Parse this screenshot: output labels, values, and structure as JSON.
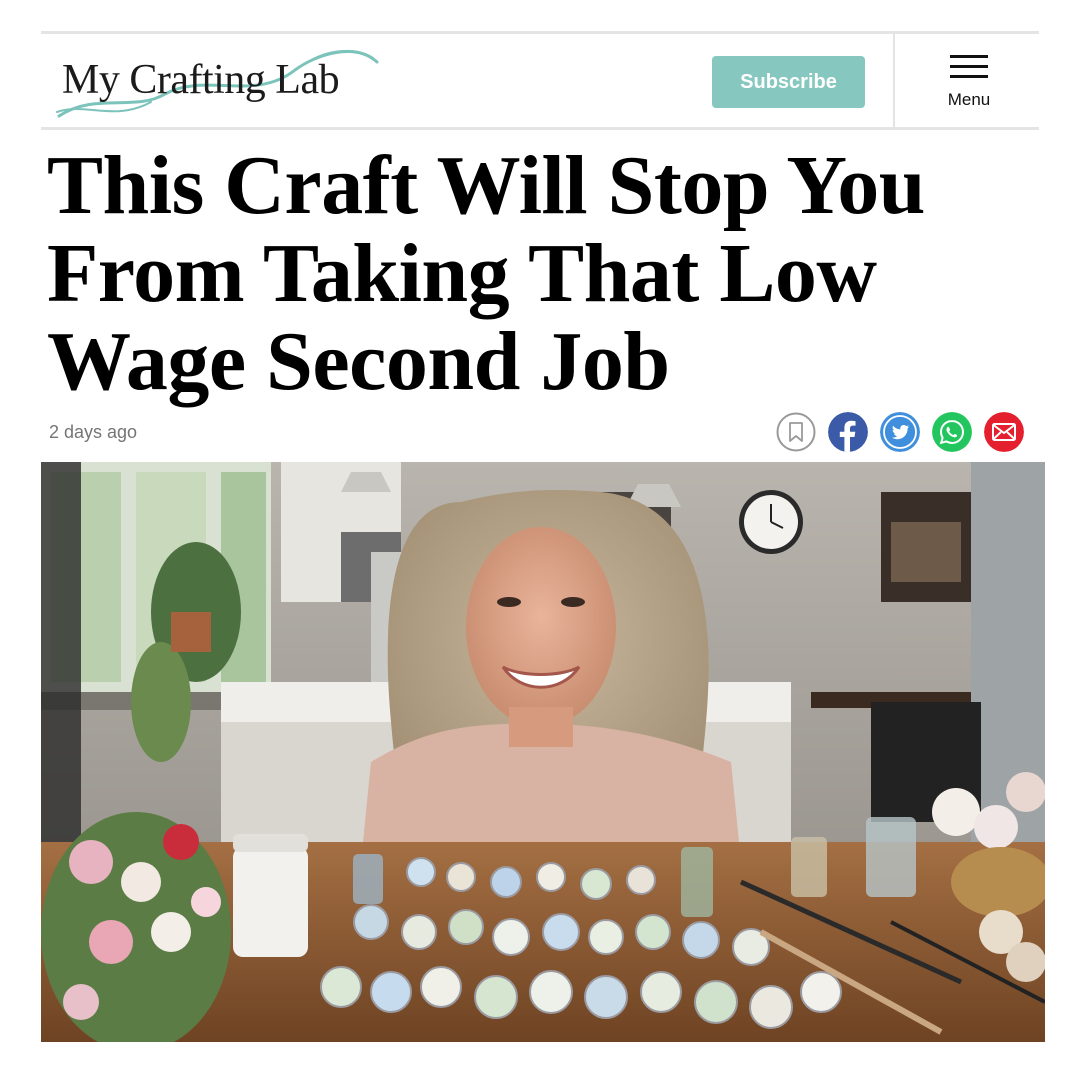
{
  "header": {
    "logo_text": "My Crafting Lab",
    "subscribe_label": "Subscribe",
    "menu_label": "Menu"
  },
  "article": {
    "headline": "This Craft Will Stop You From Taking That Low Wage Second Job",
    "date": "2 days ago"
  },
  "share_icons": [
    "bookmark-icon",
    "facebook-icon",
    "twitter-icon",
    "whatsapp-icon",
    "email-icon"
  ],
  "colors": {
    "accent": "#86c8c0",
    "logo_swoosh": "#7cc3bb",
    "facebook": "#3b5ba9",
    "twitter": "#3f8fdc",
    "whatsapp": "#22c55e",
    "email": "#e5202e"
  },
  "hero_image": {
    "icon": "photo-woman-with-pressed-flower-resin-jewelry"
  }
}
